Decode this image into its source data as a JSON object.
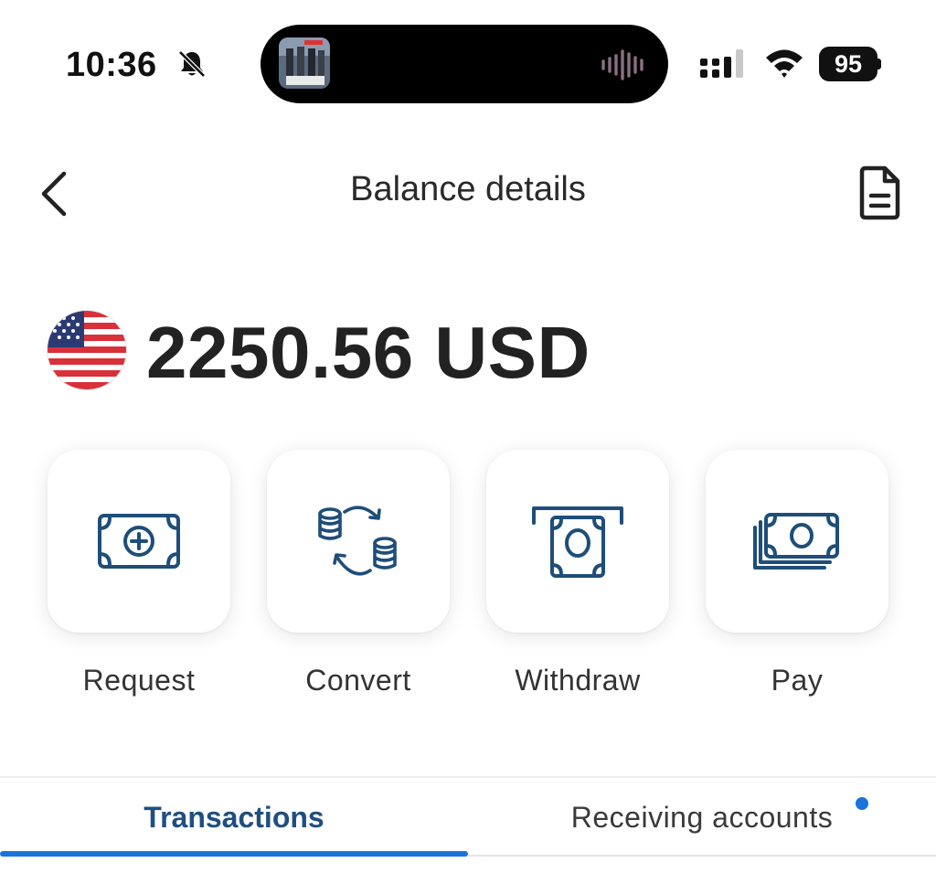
{
  "status_bar": {
    "time": "10:36",
    "battery": "95",
    "icons": [
      "bell-muted-icon",
      "waveform-icon",
      "cellular-signal-icon",
      "wifi-icon",
      "battery-icon"
    ]
  },
  "header": {
    "title": "Balance details",
    "back_icon": "chevron-left-icon",
    "statement_icon": "document-icon"
  },
  "balance": {
    "amount": "2250.56 USD",
    "currency_flag": "us-flag-icon"
  },
  "actions": [
    {
      "label": "Request",
      "icon": "banknote-plus-icon"
    },
    {
      "label": "Convert",
      "icon": "coins-exchange-icon"
    },
    {
      "label": "Withdraw",
      "icon": "atm-cash-icon"
    },
    {
      "label": "Pay",
      "icon": "banknotes-stack-icon"
    }
  ],
  "tabs": [
    {
      "label": "Transactions",
      "active": true
    },
    {
      "label": "Receiving accounts",
      "active": false,
      "has_notification_dot": true
    }
  ],
  "colors": {
    "accent": "#1a73d8",
    "active_tab_text": "#1f4f80",
    "icon_stroke": "#1e4e79",
    "text": "#222222"
  }
}
